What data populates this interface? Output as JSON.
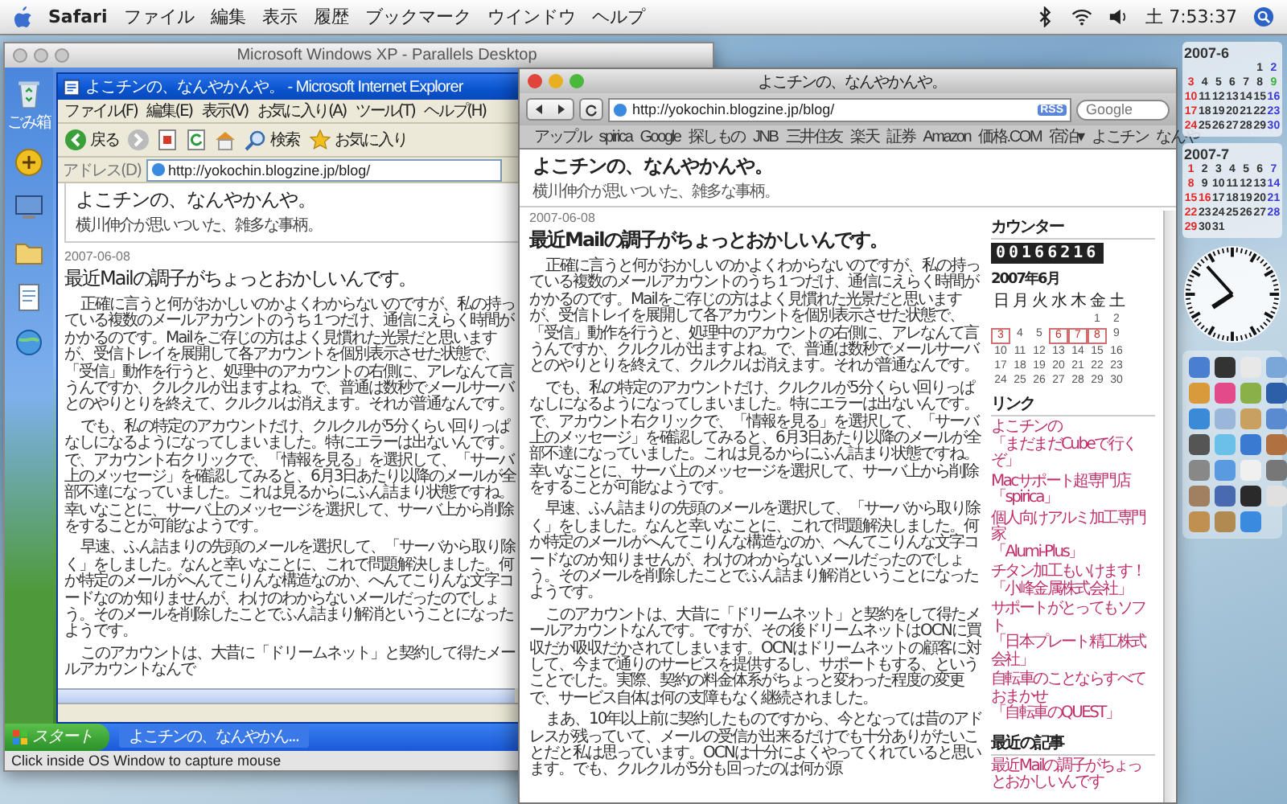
{
  "menubar": {
    "app": "Safari",
    "menus": [
      "ファイル",
      "編集",
      "表示",
      "履歴",
      "ブックマーク",
      "ウインドウ",
      "ヘルプ"
    ],
    "clock": "土 7:53:37"
  },
  "parallels": {
    "title": "Microsoft Windows XP - Parallels Desktop",
    "recycle_label": "ごみ箱",
    "ie": {
      "title": "よこチンの、なんやかんや。 - Microsoft Internet Explorer",
      "menus": [
        "ファイル(F)",
        "編集(E)",
        "表示(V)",
        "お気に入り(A)",
        "ツール(T)",
        "ヘルプ(H)"
      ],
      "back": "戻る",
      "search": "検索",
      "favorites": "お気に入り",
      "address_label": "アドレス(D)",
      "url": "http://yokochin.blogzine.jp/blog/",
      "blog_title": "よこチンの、なんやかんや。",
      "blog_subtitle": "横川伸介が思いついた、雑多な事柄。",
      "date": "2007-06-08",
      "post_title": "最近Mailの調子がちょっとおかしいんです。",
      "paragraphs": [
        "正確に言うと何がおかしいのかよくわからないのですが、私の持っている複数のメールアカウントのうち１つだけ、通信にえらく時間がかかるのです。Mailをご存じの方はよく見慣れた光景だと思いますが、受信トレイを展開して各アカウントを個別表示させた状態で、「受信」動作を行うと、処理中のアカウントの右側に、アレなんて言うんですか、クルクルが出ますよね。で、普通は数秒でメールサーバとのやりとりを終えて、クルクルは消えます。それが普通なんです。",
        "でも、私の特定のアカウントだけ、クルクルが5分くらい回りっぱなしになるようになってしまいました。特にエラーは出ないんです。で、アカウント右クリックで、「情報を見る」を選択して、「サーバ上のメッセージ」を確認してみると、6月3日あたり以降のメールが全部不達になっていました。これは見るからにふん詰まり状態ですね。幸いなことに、サーバ上のメッセージを選択して、サーバ上から削除をすることが可能なようです。",
        "早速、ふん詰まりの先頭のメールを選択して、「サーバから取り除く」をしました。なんと幸いなことに、これで問題解決しました。何か特定のメールがへんてこりんな構造なのか、へんてこりんな文字コードなのか知りませんが、わけのわからないメールだったのでしょう。そのメールを削除したことでふん詰まり解消ということになったようです。",
        "このアカウントは、大昔に「ドリームネット」と契約して得たメールアカウントなんで"
      ]
    },
    "taskbar": {
      "start": "スタート",
      "task": "よこチンの、なんやかん..."
    },
    "status": "Click inside OS Window to capture mouse"
  },
  "safari": {
    "title": "よこチンの、なんやかんや。",
    "url": "http://yokochin.blogzine.jp/blog/",
    "rss": "RSS",
    "search_placeholder": "Google",
    "bookmarks": [
      "アップル",
      "spirica",
      "Google",
      "探しもの",
      "JNB",
      "三井住友",
      "楽天",
      "証券",
      "Amazon",
      "価格.COM",
      "宿泊▾",
      "よこチン",
      "なんや"
    ],
    "blog_title": "よこチンの、なんやかんや。",
    "blog_subtitle": "横川伸介が思いついた、雑多な事柄。",
    "date": "2007-06-08",
    "post_title": "最近Mailの調子がちょっとおかしいんです。",
    "paragraphs": [
      "正確に言うと何がおかしいのかよくわからないのですが、私の持っている複数のメールアカウントのうち１つだけ、通信にえらく時間がかかるのです。Mailをご存じの方はよく見慣れた光景だと思いますが、受信トレイを展開して各アカウントを個別表示させた状態で、「受信」動作を行うと、処理中のアカウントの右側に、アレなんて言うんですか、クルクルが出ますよね。で、普通は数秒でメールサーバとのやりとりを終えて、クルクルは消えます。それが普通なんです。",
      "でも、私の特定のアカウントだけ、クルクルが5分くらい回りっぱなしになるようになってしまいました。特にエラーは出ないんです。で、アカウント右クリックで、「情報を見る」を選択して、「サーバ上のメッセージ」を確認してみると、6月3日あたり以降のメールが全部不達になっていました。これは見るからにふん詰まり状態ですね。幸いなことに、サーバ上のメッセージを選択して、サーバ上から削除をすることが可能なようです。",
      "早速、ふん詰まりの先頭のメールを選択して、「サーバから取り除く」をしました。なんと幸いなことに、これで問題解決しました。何か特定のメールがへんてこりんな構造なのか、へんてこりんな文字コードなのか知りませんが、わけのわからないメールだったのでしょう。そのメールを削除したことでふん詰まり解消ということになったようです。",
      "このアカウントは、大昔に「ドリームネット」と契約をして得たメールアカウントなんです。ですが、その後ドリームネットはOCNに買収だか吸収だかされてしまいます。OCNはドリームネットの顧客に対して、今まで通りのサービスを提供するし、サポートもする、ということでした。実際、契約の料金体系がちょっと変わった程度の変更で、サービス自体は何の支障もなく継続されました。",
      "まあ、10年以上前に契約したものですから、今となっては昔のアドレスが残っていて、メールの受信が出来るだけでも十分ありがたいことだと私は思っています。OCNは十分によくやってくれていると思います。でも、クルクルが5分も回ったのは何が原"
    ],
    "sidebar": {
      "counter_title": "カウンター",
      "counter": "00166216",
      "calendar_title": "2007年6月",
      "weekdays": [
        "日",
        "月",
        "火",
        "水",
        "木",
        "金",
        "土"
      ],
      "weeks": [
        [
          {
            "kind": "blank"
          },
          {
            "kind": "blank"
          },
          {
            "kind": "blank"
          },
          {
            "kind": "blank"
          },
          {
            "kind": "blank"
          },
          {
            "kind": "day",
            "day": "1",
            "marked": false
          },
          {
            "kind": "day",
            "day": "2",
            "marked": false
          }
        ],
        [
          {
            "kind": "day",
            "day": "3",
            "marked": true
          },
          {
            "kind": "day",
            "day": "4",
            "marked": false
          },
          {
            "kind": "day",
            "day": "5",
            "marked": false
          },
          {
            "kind": "day",
            "day": "6",
            "marked": true
          },
          {
            "kind": "day",
            "day": "7",
            "marked": true
          },
          {
            "kind": "day",
            "day": "8",
            "marked": true
          },
          {
            "kind": "day",
            "day": "9",
            "marked": false
          }
        ],
        [
          {
            "kind": "day",
            "day": "10",
            "marked": false
          },
          {
            "kind": "day",
            "day": "11",
            "marked": false
          },
          {
            "kind": "day",
            "day": "12",
            "marked": false
          },
          {
            "kind": "day",
            "day": "13",
            "marked": false
          },
          {
            "kind": "day",
            "day": "14",
            "marked": false
          },
          {
            "kind": "day",
            "day": "15",
            "marked": false
          },
          {
            "kind": "day",
            "day": "16",
            "marked": false
          }
        ],
        [
          {
            "kind": "day",
            "day": "17",
            "marked": false
          },
          {
            "kind": "day",
            "day": "18",
            "marked": false
          },
          {
            "kind": "day",
            "day": "19",
            "marked": false
          },
          {
            "kind": "day",
            "day": "20",
            "marked": false
          },
          {
            "kind": "day",
            "day": "21",
            "marked": false
          },
          {
            "kind": "day",
            "day": "22",
            "marked": false
          },
          {
            "kind": "day",
            "day": "23",
            "marked": false
          }
        ],
        [
          {
            "kind": "day",
            "day": "24",
            "marked": false
          },
          {
            "kind": "day",
            "day": "25",
            "marked": false
          },
          {
            "kind": "day",
            "day": "26",
            "marked": false
          },
          {
            "kind": "day",
            "day": "27",
            "marked": false
          },
          {
            "kind": "day",
            "day": "28",
            "marked": false
          },
          {
            "kind": "day",
            "day": "29",
            "marked": false
          },
          {
            "kind": "day",
            "day": "30",
            "marked": false
          }
        ]
      ],
      "links_title": "リンク",
      "links": [
        {
          "line_1": "よこチンの",
          "line_2": "「まだまだCubeで行くぞ」"
        },
        {
          "line_1": "Macサポート超専門店",
          "line_2": "「spirica」"
        },
        {
          "line_1": "個人向けアルミ加工専門家",
          "line_2": "「Alumi-Plus」"
        },
        {
          "line_1": "チタン加工もいけます！",
          "line_2": "「小峰金属株式会社」"
        },
        {
          "line_1": "サポートがとってもソフト",
          "line_2": "「日本プレート精工株式会社」"
        },
        {
          "line_1": "自転車のことならすべておまかせ",
          "line_2": "「自転車のQUEST」"
        }
      ],
      "recent_title": "最近の記事",
      "recent": [
        "最近Mailの調子がちょっとおかしいんです"
      ]
    }
  },
  "desktop_calendar": {
    "months": [
      {
        "title": "2007-6",
        "weeks": [
          [
            {
              "kind": "blank"
            },
            {
              "kind": "blank"
            },
            {
              "kind": "blank"
            },
            {
              "kind": "blank"
            },
            {
              "kind": "blank"
            },
            {
              "kind": "day",
              "day": "1",
              "today": false,
              "holiday": false
            },
            {
              "kind": "day",
              "day": "2",
              "today": false,
              "holiday": false
            }
          ],
          [
            {
              "kind": "day",
              "day": "3",
              "today": false,
              "holiday": true
            },
            {
              "kind": "day",
              "day": "4",
              "today": false,
              "holiday": false
            },
            {
              "kind": "day",
              "day": "5",
              "today": false,
              "holiday": false
            },
            {
              "kind": "day",
              "day": "6",
              "today": false,
              "holiday": false
            },
            {
              "kind": "day",
              "day": "7",
              "today": false,
              "holiday": false
            },
            {
              "kind": "day",
              "day": "8",
              "today": false,
              "holiday": false
            },
            {
              "kind": "day",
              "day": "9",
              "today": true,
              "holiday": false
            }
          ],
          [
            {
              "kind": "day",
              "day": "10",
              "today": false,
              "holiday": true
            },
            {
              "kind": "day",
              "day": "11",
              "today": false,
              "holiday": false
            },
            {
              "kind": "day",
              "day": "12",
              "today": false,
              "holiday": false
            },
            {
              "kind": "day",
              "day": "13",
              "today": false,
              "holiday": false
            },
            {
              "kind": "day",
              "day": "14",
              "today": false,
              "holiday": false
            },
            {
              "kind": "day",
              "day": "15",
              "today": false,
              "holiday": false
            },
            {
              "kind": "day",
              "day": "16",
              "today": false,
              "holiday": false
            }
          ],
          [
            {
              "kind": "day",
              "day": "17",
              "today": false,
              "holiday": true
            },
            {
              "kind": "day",
              "day": "18",
              "today": false,
              "holiday": false
            },
            {
              "kind": "day",
              "day": "19",
              "today": false,
              "holiday": false
            },
            {
              "kind": "day",
              "day": "20",
              "today": false,
              "holiday": false
            },
            {
              "kind": "day",
              "day": "21",
              "today": false,
              "holiday": false
            },
            {
              "kind": "day",
              "day": "22",
              "today": false,
              "holiday": false
            },
            {
              "kind": "day",
              "day": "23",
              "today": false,
              "holiday": false
            }
          ],
          [
            {
              "kind": "day",
              "day": "24",
              "today": false,
              "holiday": true
            },
            {
              "kind": "day",
              "day": "25",
              "today": false,
              "holiday": false
            },
            {
              "kind": "day",
              "day": "26",
              "today": false,
              "holiday": false
            },
            {
              "kind": "day",
              "day": "27",
              "today": false,
              "holiday": false
            },
            {
              "kind": "day",
              "day": "28",
              "today": false,
              "holiday": false
            },
            {
              "kind": "day",
              "day": "29",
              "today": false,
              "holiday": false
            },
            {
              "kind": "day",
              "day": "30",
              "today": false,
              "holiday": false
            }
          ]
        ]
      },
      {
        "title": "2007-7",
        "weeks": [
          [
            {
              "kind": "day",
              "day": "1",
              "today": false,
              "holiday": true
            },
            {
              "kind": "day",
              "day": "2",
              "today": false,
              "holiday": false
            },
            {
              "kind": "day",
              "day": "3",
              "today": false,
              "holiday": false
            },
            {
              "kind": "day",
              "day": "4",
              "today": false,
              "holiday": false
            },
            {
              "kind": "day",
              "day": "5",
              "today": false,
              "holiday": false
            },
            {
              "kind": "day",
              "day": "6",
              "today": false,
              "holiday": false
            },
            {
              "kind": "day",
              "day": "7",
              "today": false,
              "holiday": false
            }
          ],
          [
            {
              "kind": "day",
              "day": "8",
              "today": false,
              "holiday": true
            },
            {
              "kind": "day",
              "day": "9",
              "today": false,
              "holiday": false
            },
            {
              "kind": "day",
              "day": "10",
              "today": false,
              "holiday": false
            },
            {
              "kind": "day",
              "day": "11",
              "today": false,
              "holiday": false
            },
            {
              "kind": "day",
              "day": "12",
              "today": false,
              "holiday": false
            },
            {
              "kind": "day",
              "day": "13",
              "today": false,
              "holiday": false
            },
            {
              "kind": "day",
              "day": "14",
              "today": false,
              "holiday": false
            }
          ],
          [
            {
              "kind": "day",
              "day": "15",
              "today": false,
              "holiday": true
            },
            {
              "kind": "day",
              "day": "16",
              "today": false,
              "holiday": true
            },
            {
              "kind": "day",
              "day": "17",
              "today": false,
              "holiday": false
            },
            {
              "kind": "day",
              "day": "18",
              "today": false,
              "holiday": false
            },
            {
              "kind": "day",
              "day": "19",
              "today": false,
              "holiday": false
            },
            {
              "kind": "day",
              "day": "20",
              "today": false,
              "holiday": false
            },
            {
              "kind": "day",
              "day": "21",
              "today": false,
              "holiday": false
            }
          ],
          [
            {
              "kind": "day",
              "day": "22",
              "today": false,
              "holiday": true
            },
            {
              "kind": "day",
              "day": "23",
              "today": false,
              "holiday": false
            },
            {
              "kind": "day",
              "day": "24",
              "today": false,
              "holiday": false
            },
            {
              "kind": "day",
              "day": "25",
              "today": false,
              "holiday": false
            },
            {
              "kind": "day",
              "day": "26",
              "today": false,
              "holiday": false
            },
            {
              "kind": "day",
              "day": "27",
              "today": false,
              "holiday": false
            },
            {
              "kind": "day",
              "day": "28",
              "today": false,
              "holiday": false
            }
          ],
          [
            {
              "kind": "day",
              "day": "29",
              "today": false,
              "holiday": true
            },
            {
              "kind": "day",
              "day": "30",
              "today": false,
              "holiday": false
            },
            {
              "kind": "day",
              "day": "31",
              "today": false,
              "holiday": false
            }
          ]
        ]
      }
    ]
  }
}
